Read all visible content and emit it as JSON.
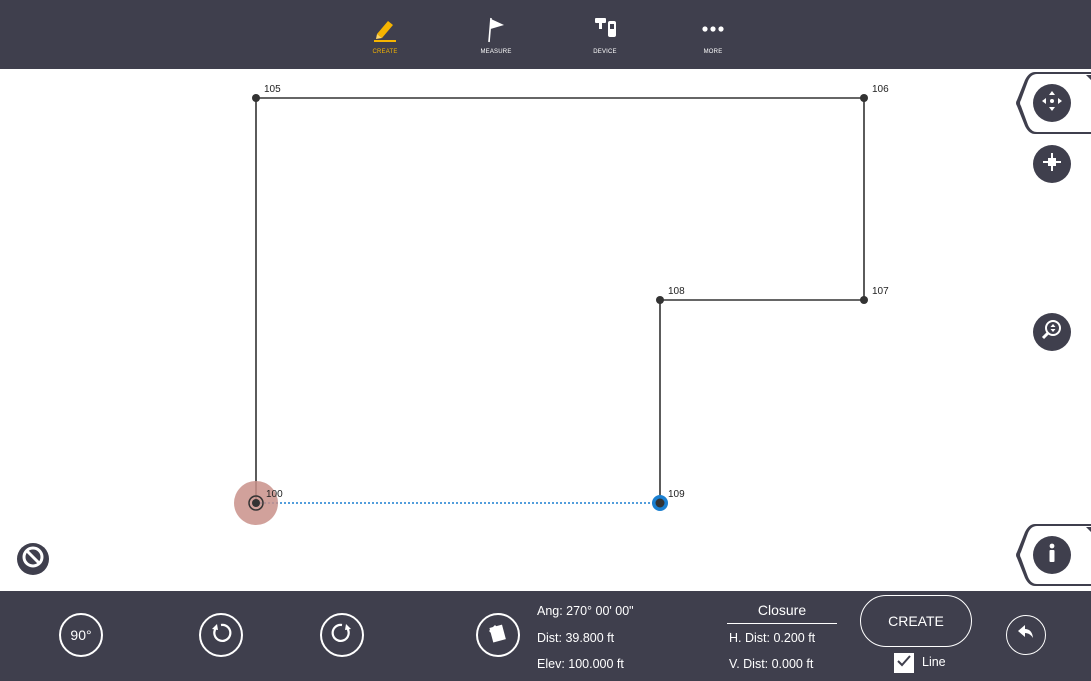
{
  "toolbar": {
    "items": [
      {
        "label": "CREATE",
        "icon": "pencil-icon",
        "active": true
      },
      {
        "label": "MEASURE",
        "icon": "flag-icon",
        "active": false
      },
      {
        "label": "DEVICE",
        "icon": "device-icon",
        "active": false
      },
      {
        "label": "MORE",
        "icon": "more-dots-icon",
        "active": false
      }
    ]
  },
  "points": [
    {
      "id": "105"
    },
    {
      "id": "106"
    },
    {
      "id": "107"
    },
    {
      "id": "108"
    },
    {
      "id": "109"
    },
    {
      "id": "100"
    }
  ],
  "controls": {
    "rotate_label": "90°"
  },
  "measurement": {
    "angle": "Ang: 270° 00' 00\"",
    "distance": "Dist: 39.800 ft",
    "elevation": "Elev: 100.000 ft"
  },
  "closure": {
    "title": "Closure",
    "h_dist": "H. Dist: 0.200 ft",
    "v_dist": "V. Dist: 0.000 ft"
  },
  "create": {
    "button_label": "CREATE",
    "line_label": "Line",
    "line_checked": true
  },
  "colors": {
    "bar": "#3f3f4d",
    "accent": "#f5b400",
    "selection": "#1a7fd0",
    "start_highlight": "#c9908a"
  }
}
